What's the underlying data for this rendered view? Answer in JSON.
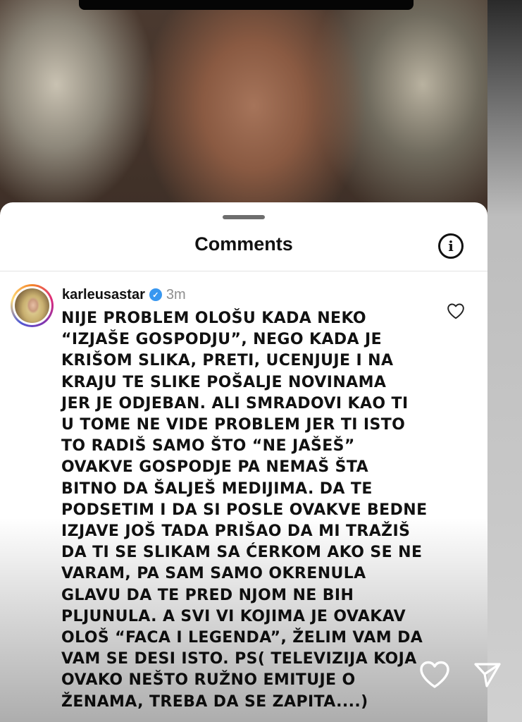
{
  "sheet": {
    "title": "Comments",
    "info_icon": "info-icon",
    "info_glyph": "i"
  },
  "comment": {
    "username": "karleusastar",
    "verified_icon": "verified-badge-icon",
    "verified_glyph": "✓",
    "time": "3m",
    "like_icon": "heart-outline-icon",
    "lines": [
      "NIJE PROBLEM OLOŠU KADA NEKO",
      "“IZJAŠE GOSPODJU”, NEGO KADA JE",
      "KRIŠOM SLIKA, PRETI, UCENJUJE I NA",
      "KRAJU TE SLIKE POŠALJE NOVINAMA",
      "JER JE ODJEBAN. ALI SMRADOVI KAO TI",
      "U TOME NE VIDE PROBLEM JER TI ISTO",
      "TO RADIŠ SAMO ŠTO “NE JAŠEŠ”",
      "OVAKVE GOSPODJE PA NEMAŠ ŠTA",
      "BITNO DA ŠALJEŠ MEDIJIMA. DA TE",
      "PODSETIM I DA SI POSLE OVAKVE BEDNE",
      "IZJAVE JOŠ TADA PRIŠAO DA MI TRAŽIŠ",
      "DA TI SE SLIKAM SA ĆERKOM AKO SE NE",
      "VARAM, PA SAM SAMO OKRENULA",
      "GLAVU DA TE PRED NJOM NE BIH",
      "PLJUNULA. A SVI VI KOJIMA JE OVAKAV",
      "OLOŠ “FACA I LEGENDA”, ŽELIM VAM DA",
      "VAM SE DESI ISTO. PS( TELEVIZIJA KOJA",
      "OVAKO NEŠTO RUŽNO EMITUJE O",
      "ŽENAMA, TREBA DA SE ZAPITA....)"
    ]
  },
  "story_actions": {
    "like_icon": "heart-icon",
    "share_icon": "send-icon"
  },
  "colors": {
    "sheet_bg": "#ffffff",
    "text": "#111111",
    "muted": "#8e8e8e",
    "verified": "#3897f0"
  }
}
